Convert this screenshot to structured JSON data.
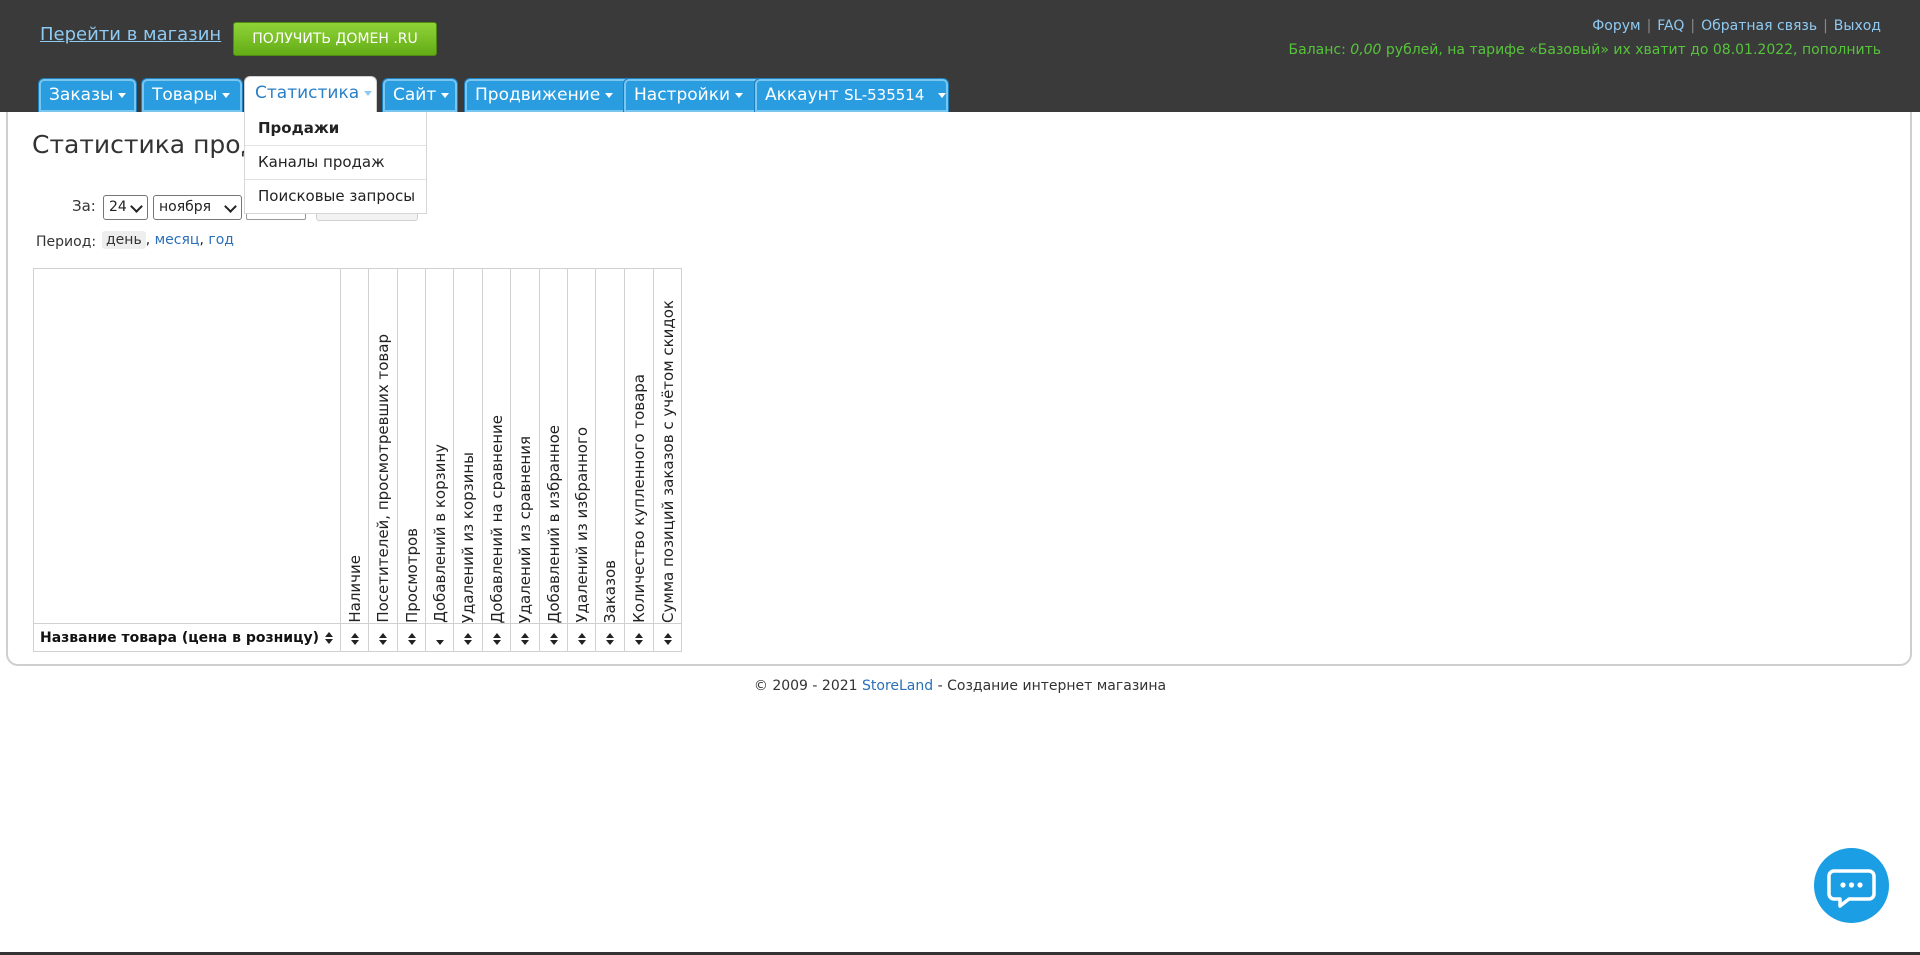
{
  "header": {
    "shop_link": "Перейти в магазин",
    "domain_button": "ПОЛУЧИТЬ ДОМЕН .RU",
    "top_links": {
      "forum": "Форум",
      "faq": "FAQ",
      "feedback": "Обратная связь",
      "logout": "Выход"
    },
    "balance": {
      "prefix": "Баланс: ",
      "amount": "0,00",
      "middle": " рублей, на тарифе «Базовый» их хватит до 08.01.2022, ",
      "topup": "пополнить"
    }
  },
  "nav": {
    "tabs": [
      {
        "label": "Заказы"
      },
      {
        "label": "Товары"
      },
      {
        "label": "Статистика"
      },
      {
        "label": "Сайт"
      },
      {
        "label": "Продвижение"
      },
      {
        "label": "Настройки"
      },
      {
        "label": "Аккаунт",
        "suffix": "SL-535514"
      }
    ],
    "active": "Статистика"
  },
  "dropdown": {
    "items": [
      "Продажи",
      "Каналы продаж",
      "Поисковые запросы"
    ]
  },
  "page": {
    "title": "Статистика продаж",
    "filter_label": "За:",
    "day_value": "24",
    "month_value": "ноября",
    "period_label": "Период:",
    "period_current": "день",
    "period_month": "месяц",
    "period_year": "год"
  },
  "table": {
    "name_column": "Название товара (цена в розницу)",
    "columns": [
      "Наличие",
      "Посетителей, просмотревших товар",
      "Просмотров",
      "Добавлений в корзину",
      "Удалений из корзины",
      "Добавлений на сравнение",
      "Удалений из сравнения",
      "Добавлений в избранное",
      "Удалений из избранного",
      "Заказов",
      "Количество купленного товара",
      "Сумма позиций заказов с учётом скидок"
    ]
  },
  "footer": {
    "copyright": "© 2009 - 2021 ",
    "brand": "StoreLand",
    "tail": " - Создание интернет магазина"
  },
  "colors": {
    "header_bg": "#3a3a3a",
    "tab_blue": "#2a9de0",
    "balance_green": "#56c43a",
    "link_blue": "#2a6fb8"
  },
  "icons": {
    "chat": "chat-bubble-icon",
    "sort": "sort-arrows-icon"
  }
}
